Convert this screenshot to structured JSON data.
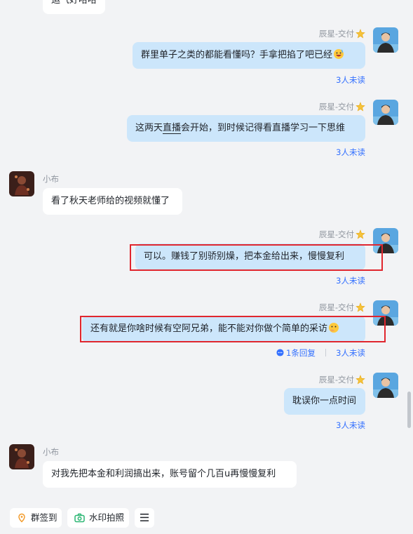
{
  "messages": {
    "top_partial": "运气好哈哈",
    "m1": {
      "sender": "辰星-交付",
      "text": "群里单子之类的都能看懂吗？手拿把掐了吧已经",
      "read": "3人未读"
    },
    "m2": {
      "sender": "辰星-交付",
      "text_pre": "这两天",
      "text_mid": "直播",
      "text_post": "会开始，到时候记得看直播学习一下思维",
      "read": "3人未读"
    },
    "m3": {
      "sender": "小布",
      "text": "看了秋天老师给的视频就懂了"
    },
    "m4": {
      "sender": "辰星-交付",
      "text": "可以。赚钱了别骄别燥，把本金给出来，慢慢复利",
      "read": "3人未读"
    },
    "m5": {
      "sender": "辰星-交付",
      "text": "还有就是你啥时候有空阿兄弟，能不能对你做个简单的采访",
      "reply": "1条回复",
      "read": "3人未读"
    },
    "m6": {
      "sender": "辰星-交付",
      "text": "耽误你一点时间",
      "read": "3人未读"
    },
    "m7": {
      "sender": "小布",
      "text": "对我先把本金和利润搞出来，账号留个几百u再慢慢复利"
    }
  },
  "toolbar": {
    "checkin": "群签到",
    "photo": "水印拍照"
  },
  "colors": {
    "outgoing_bubble": "#cce6fb",
    "incoming_bubble": "#ffffff",
    "link": "#3370ff",
    "highlight": "#e0262e"
  }
}
